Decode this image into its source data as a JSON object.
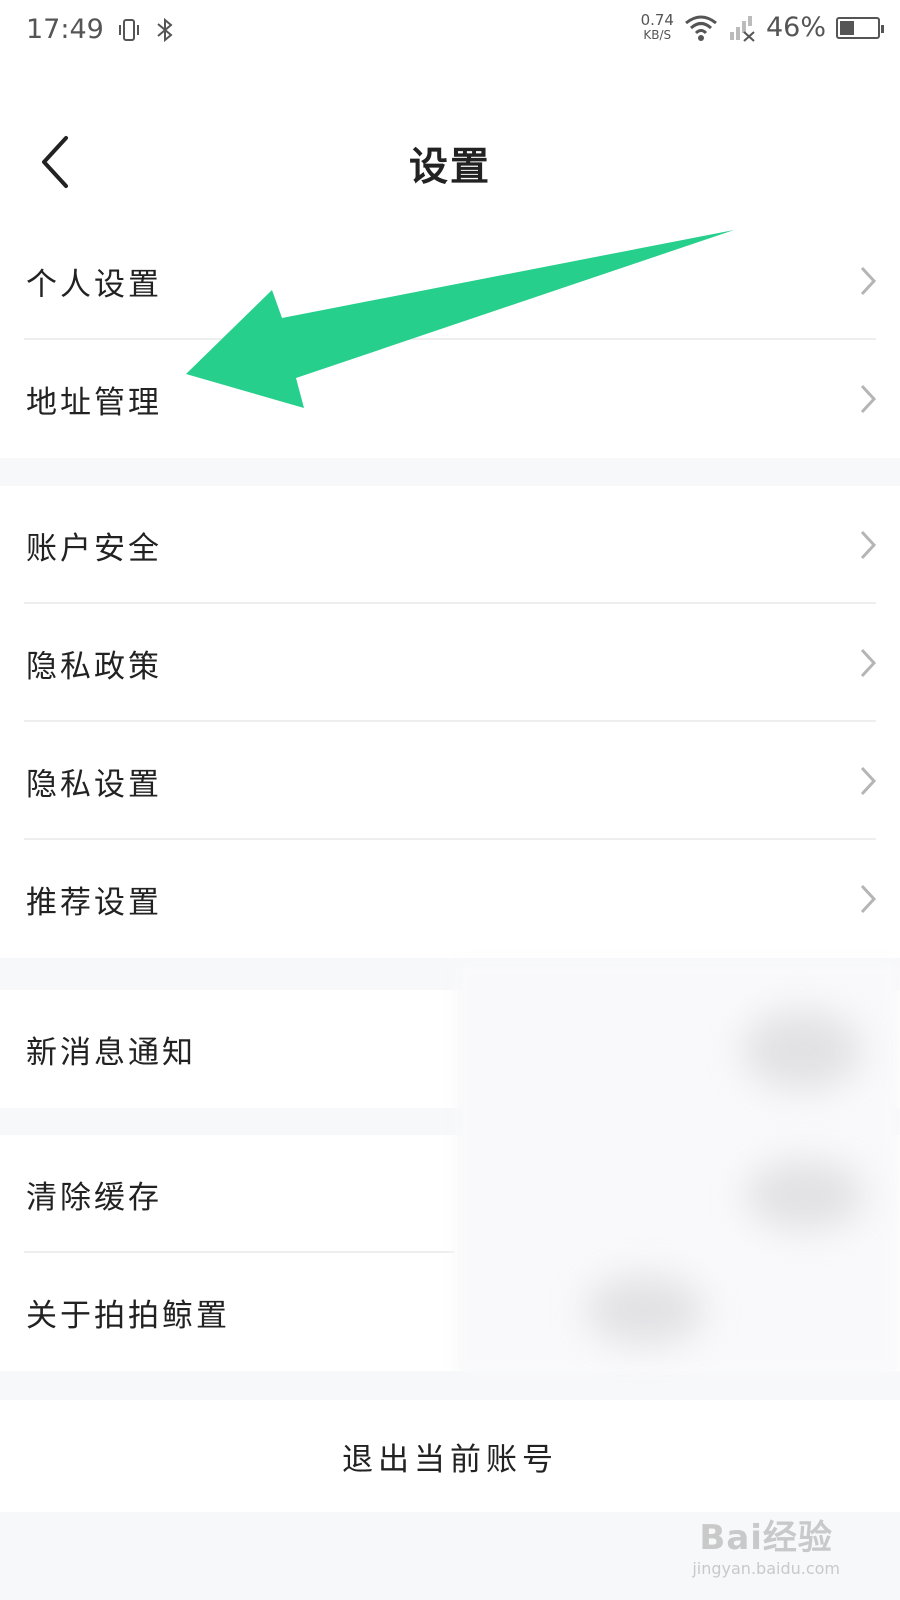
{
  "status_bar": {
    "time": "17:49",
    "net_speed_value": "0.74",
    "net_speed_unit": "KB/S",
    "battery_percent": "46%",
    "battery_level": 0.46
  },
  "header": {
    "title": "设置"
  },
  "groups": [
    {
      "items": [
        {
          "label": "个人设置"
        },
        {
          "label": "地址管理"
        }
      ]
    },
    {
      "items": [
        {
          "label": "账户安全"
        },
        {
          "label": "隐私政策"
        },
        {
          "label": "隐私设置"
        },
        {
          "label": "推荐设置"
        }
      ]
    },
    {
      "items": [
        {
          "label": "新消息通知"
        }
      ]
    },
    {
      "items": [
        {
          "label": "清除缓存"
        },
        {
          "label": "关于拍拍鲸置"
        }
      ]
    }
  ],
  "logout": {
    "label": "退出当前账号"
  },
  "annotation": {
    "arrow_color": "#26cf8c"
  },
  "watermark": {
    "line1": "Bai经验",
    "line2": "jingyan.baidu.com"
  }
}
